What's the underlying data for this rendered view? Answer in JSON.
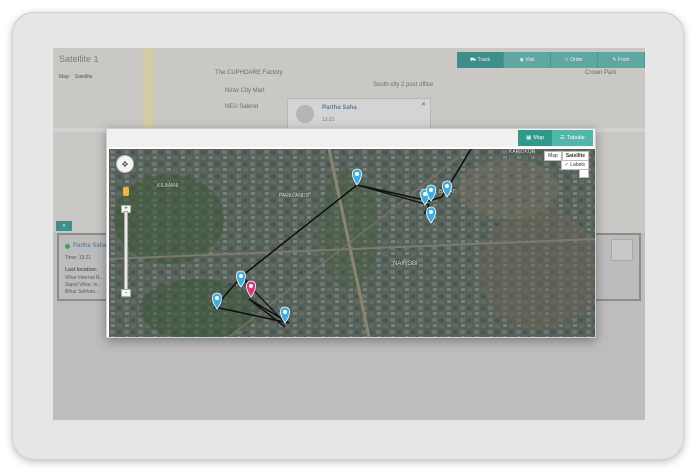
{
  "background_page": {
    "title": "Satellite 1",
    "map_tabs": [
      "Map",
      "Satellite"
    ],
    "action_buttons": [
      {
        "label": "Track",
        "icon": "truck-icon"
      },
      {
        "label": "Visit",
        "icon": "eye-icon"
      },
      {
        "label": "Order",
        "icon": "cart-icon"
      },
      {
        "label": "Form",
        "icon": "form-icon"
      }
    ],
    "map_labels": [
      "The CUPHOARE Factory",
      "Nirav City Mart",
      "NEU Salend",
      "South city 2 post office",
      "Crown Park"
    ],
    "popup": {
      "name": "Partha Saha",
      "time": "13:21"
    },
    "panel": {
      "tab": "«",
      "name": "Partha Saha",
      "time_label": "Time: 13:21",
      "last_location_label": "Last location:",
      "address_lines": [
        "Vihar Internal R...",
        "Sapal Vihar, In...",
        "Bihar Sekhan..."
      ]
    }
  },
  "modal": {
    "toggle": [
      {
        "label": "Map",
        "icon": "map-icon",
        "active": true
      },
      {
        "label": "Tabular",
        "icon": "table-icon",
        "active": false
      }
    ],
    "map_type": [
      "Map",
      "Satellite"
    ],
    "labels_option": "Labels",
    "map_labels": [
      "KILIMANI",
      "KARIOKOR",
      "BAHATI",
      "NAIROBI",
      "PARKLANDS"
    ],
    "zoom_in": "+",
    "zoom_out": "-"
  },
  "colors": {
    "accent": "#52b7a9",
    "accent_dark": "#2f9a8c",
    "marker": "#3eaee0",
    "marker_active": "#e0337a"
  }
}
